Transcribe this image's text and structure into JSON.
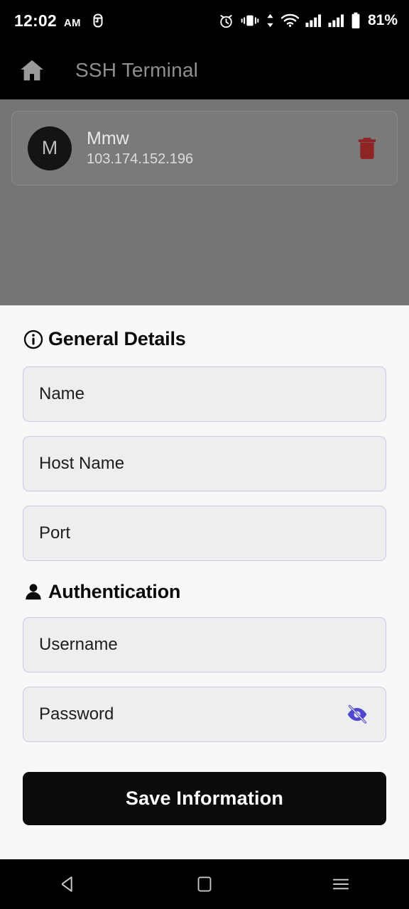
{
  "status_bar": {
    "time": "12:02",
    "ampm": "AM",
    "battery_percent": "81%",
    "icons": [
      "notification-badge-icon",
      "alarm-icon",
      "vibrate-icon",
      "data-transfer-icon",
      "wifi-icon",
      "signal-bars-1-icon",
      "signal-bars-2-icon",
      "battery-icon"
    ]
  },
  "app_bar": {
    "home_icon": "home-icon",
    "title": "SSH Terminal"
  },
  "connection_list": {
    "items": [
      {
        "avatar_initial": "M",
        "name": "Mmw",
        "host": "103.174.152.196",
        "delete_icon": "trash-icon"
      }
    ]
  },
  "sheet": {
    "sections": [
      {
        "icon": "info-circle-icon",
        "title": "General Details"
      },
      {
        "icon": "person-icon",
        "title": "Authentication"
      }
    ],
    "fields": {
      "name": {
        "placeholder": "Name",
        "value": ""
      },
      "host_name": {
        "placeholder": "Host Name",
        "value": ""
      },
      "port": {
        "placeholder": "Port",
        "value": ""
      },
      "username": {
        "placeholder": "Username",
        "value": ""
      },
      "password": {
        "placeholder": "Password",
        "value": "",
        "toggle_icon": "eye-off-icon"
      }
    },
    "save_label": "Save Information"
  },
  "nav_bar": {
    "back": "back-triangle-icon",
    "home": "home-square-icon",
    "recents": "recents-menu-icon"
  },
  "colors": {
    "accent_purple": "#4f46cd",
    "field_border": "#c9cae6",
    "field_fill": "#eeeef0",
    "scrim": "#757575",
    "sheet_bg": "#f8f8f9",
    "delete_red": "#8e2424",
    "button_black": "#0b0b0b",
    "appbar_title": "#8f8f8f"
  }
}
